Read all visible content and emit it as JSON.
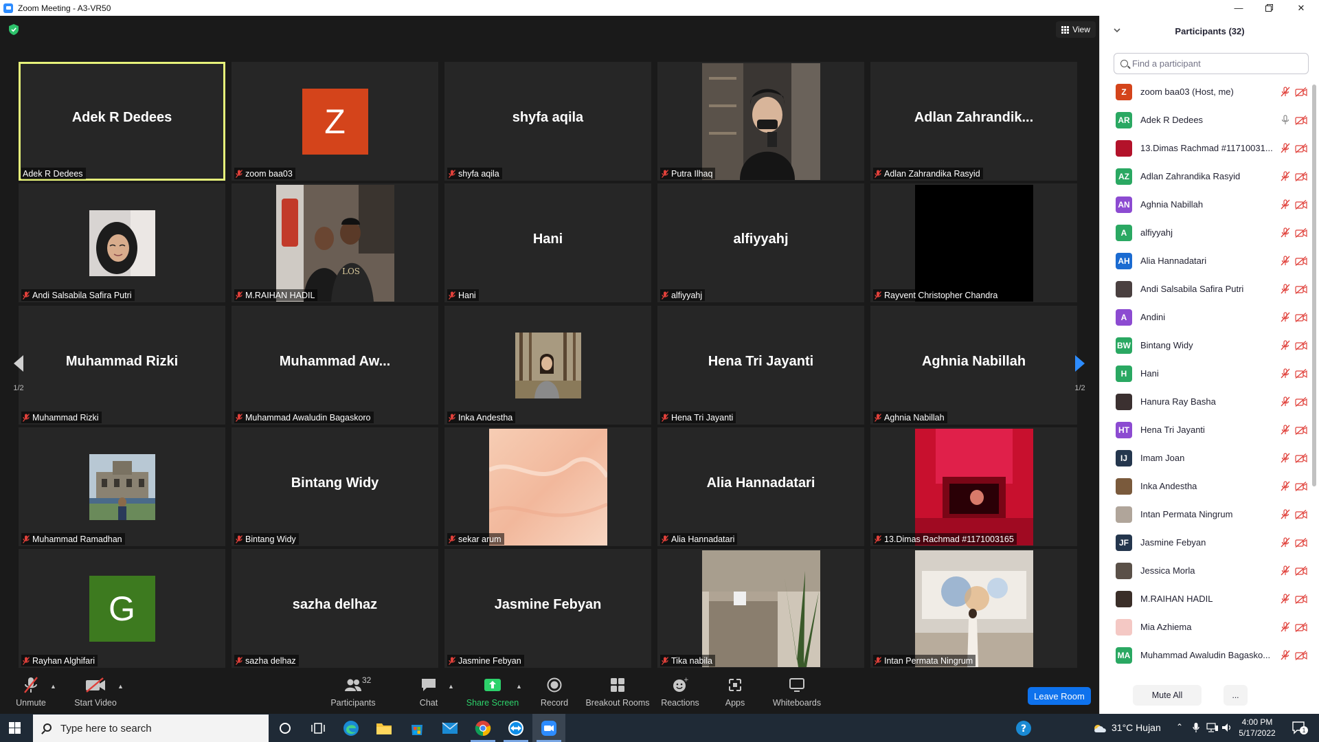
{
  "window": {
    "title": "Zoom Meeting - A3-VR50",
    "controls": [
      "minimize",
      "maximize",
      "close"
    ]
  },
  "video": {
    "view_label": "View",
    "page_indicator": "1/2",
    "tiles": [
      {
        "name": "Adek R Dedees",
        "label": "Adek R Dedees",
        "type": "name",
        "active": true,
        "muted": false
      },
      {
        "name": "zoom baa03",
        "label": "zoom baa03",
        "type": "letter",
        "letter": "Z",
        "color": "#d4441b"
      },
      {
        "name": "shyfa aqila",
        "label": "shyfa aqila",
        "type": "name"
      },
      {
        "name": "Putra Ilhaq",
        "label": "Putra Ilhaq",
        "type": "photo",
        "photo": "mirror-selfie"
      },
      {
        "name": "Adlan  Zahrandik...",
        "label": "Adlan Zahrandika Rasyid",
        "type": "name"
      },
      {
        "name": "Andi Salsabila Safira Putri",
        "label": "Andi Salsabila Safira Putri",
        "type": "photo",
        "photo": "hijab-portrait"
      },
      {
        "name": "M.RAIHAN HADIL",
        "label": "M.RAIHAN HADIL",
        "type": "photo",
        "photo": "two-people"
      },
      {
        "name": "Hani",
        "label": "Hani",
        "type": "name"
      },
      {
        "name": "alfiyyahj",
        "label": "alfiyyahj",
        "type": "name"
      },
      {
        "name": "Rayvent Christopher Chandra",
        "label": "Rayvent Christopher Chandra",
        "type": "photo",
        "photo": "black"
      },
      {
        "name": "Muhammad Rizki",
        "label": "Muhammad Rizki",
        "type": "name"
      },
      {
        "name": "Muhammad  Aw...",
        "label": "Muhammad Awaludin Bagaskoro",
        "type": "name"
      },
      {
        "name": "Inka Andestha",
        "label": "Inka Andestha",
        "type": "photo",
        "photo": "forest"
      },
      {
        "name": "Hena Tri Jayanti",
        "label": "Hena Tri Jayanti",
        "type": "name"
      },
      {
        "name": "Aghnia Nabillah",
        "label": "Aghnia Nabillah",
        "type": "name"
      },
      {
        "name": "Muhammad Ramadhan",
        "label": "Muhammad Ramadhan",
        "type": "photo",
        "photo": "building"
      },
      {
        "name": "Bintang Widy",
        "label": "Bintang Widy",
        "type": "name"
      },
      {
        "name": "sekar arum",
        "label": "sekar arum",
        "type": "photo",
        "photo": "peach"
      },
      {
        "name": "Alia Hannadatari",
        "label": "Alia Hannadatari",
        "type": "name"
      },
      {
        "name": "13.Dimas Rachmad #1171003165",
        "label": "13.Dimas Rachmad #1171003165",
        "type": "photo",
        "photo": "red-room"
      },
      {
        "name": "Rayhan Alghifari",
        "label": "Rayhan Alghifari",
        "type": "letter",
        "letter": "G",
        "color": "#3d7a1f"
      },
      {
        "name": "sazha delhaz",
        "label": "sazha delhaz",
        "type": "name"
      },
      {
        "name": "Jasmine Febyan",
        "label": "Jasmine Febyan",
        "type": "name"
      },
      {
        "name": "Tika nabila",
        "label": "Tika nabila",
        "type": "photo",
        "photo": "plant"
      },
      {
        "name": "Intan Permata Ningrum",
        "label": "Intan Permata Ningrum",
        "type": "photo",
        "photo": "gallery"
      }
    ]
  },
  "panel": {
    "title": "Participants (32)",
    "search_placeholder": "Find a participant",
    "participants": [
      {
        "name": "zoom baa03 (Host, me)",
        "initials": "Z",
        "color": "#d4441b",
        "mic": "muted"
      },
      {
        "name": "Adek R Dedees",
        "initials": "AR",
        "color": "#2aa862",
        "mic": "on"
      },
      {
        "name": "13.Dimas Rachmad #11710031...",
        "initials": "",
        "color": "#b3122a",
        "mic": "muted"
      },
      {
        "name": "Adlan Zahrandika Rasyid",
        "initials": "AZ",
        "color": "#2aa862",
        "mic": "muted"
      },
      {
        "name": "Aghnia Nabillah",
        "initials": "AN",
        "color": "#8c4bd1",
        "mic": "muted"
      },
      {
        "name": "alfiyyahj",
        "initials": "A",
        "color": "#2aa862",
        "mic": "muted"
      },
      {
        "name": "Alia Hannadatari",
        "initials": "AH",
        "color": "#1b6bd1",
        "mic": "muted"
      },
      {
        "name": "Andi Salsabila Safira Putri",
        "initials": "",
        "color": "#4a4040",
        "mic": "muted"
      },
      {
        "name": "Andini",
        "initials": "A",
        "color": "#8c4bd1",
        "mic": "muted"
      },
      {
        "name": "Bintang Widy",
        "initials": "BW",
        "color": "#2aa862",
        "mic": "muted"
      },
      {
        "name": "Hani",
        "initials": "H",
        "color": "#2aa862",
        "mic": "muted"
      },
      {
        "name": "Hanura Ray Basha",
        "initials": "",
        "color": "#3b3030",
        "mic": "muted"
      },
      {
        "name": "Hena Tri Jayanti",
        "initials": "HT",
        "color": "#8c4bd1",
        "mic": "muted"
      },
      {
        "name": "Imam Joan",
        "initials": "IJ",
        "color": "#24364d",
        "mic": "muted"
      },
      {
        "name": "Inka Andestha",
        "initials": "",
        "color": "#7a5a3c",
        "mic": "muted"
      },
      {
        "name": "Intan Permata Ningrum",
        "initials": "",
        "color": "#b0a59a",
        "mic": "muted"
      },
      {
        "name": "Jasmine Febyan",
        "initials": "JF",
        "color": "#24364d",
        "mic": "muted"
      },
      {
        "name": "Jessica Morla",
        "initials": "",
        "color": "#5a5048",
        "mic": "muted"
      },
      {
        "name": "M.RAIHAN HADIL",
        "initials": "",
        "color": "#3a2e28",
        "mic": "muted"
      },
      {
        "name": "Mia Azhiema",
        "initials": "",
        "color": "#f4c8c4",
        "mic": "muted"
      },
      {
        "name": "Muhammad Awaludin Bagasko...",
        "initials": "MA",
        "color": "#2aa862",
        "mic": "muted"
      }
    ],
    "mute_all_label": "Mute All",
    "more_label": "..."
  },
  "toolbar": {
    "unmute": "Unmute",
    "start_video": "Start Video",
    "participants": "Participants",
    "participants_count": "32",
    "chat": "Chat",
    "share_screen": "Share Screen",
    "record": "Record",
    "breakout_rooms": "Breakout Rooms",
    "reactions": "Reactions",
    "apps": "Apps",
    "whiteboards": "Whiteboards",
    "leave": "Leave Room"
  },
  "taskbar": {
    "search_placeholder": "Type here to search",
    "weather": "31°C  Hujan",
    "time": "4:00 PM",
    "date": "5/17/2022",
    "notification_count": "1"
  }
}
